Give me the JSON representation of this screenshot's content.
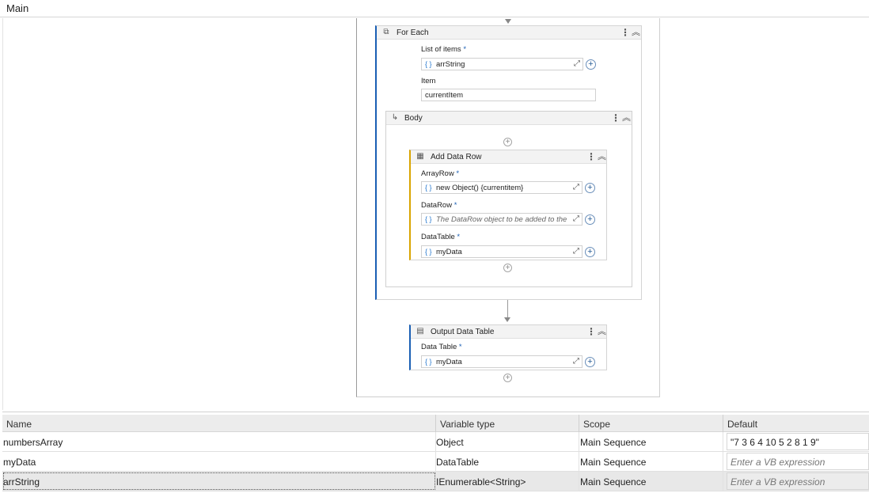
{
  "tab": {
    "title": "Main"
  },
  "for_each": {
    "title": "For Each",
    "list_label": "List of items",
    "list_value": "arrString",
    "item_label": "Item",
    "item_value": "currentItem",
    "body_title": "Body"
  },
  "add_data_row": {
    "title": "Add Data Row",
    "array_row_label": "ArrayRow",
    "array_row_value": "new Object() {currentitem}",
    "data_row_label": "DataRow",
    "data_row_placeholder": "The DataRow object to be added to the Dat",
    "data_table_label": "DataTable",
    "data_table_value": "myData"
  },
  "output_data_table": {
    "title": "Output Data Table",
    "data_table_label": "Data Table",
    "data_table_value": "myData"
  },
  "variables": {
    "headers": [
      "Name",
      "Variable type",
      "Scope",
      "Default"
    ],
    "rows": [
      {
        "name": "numbersArray",
        "type": "Object",
        "scope": "Main Sequence",
        "default": "\"7 3 6 4 10 5 2 8 1 9\"",
        "placeholder": false
      },
      {
        "name": "myData",
        "type": "DataTable",
        "scope": "Main Sequence",
        "default": "Enter a VB expression",
        "placeholder": true
      },
      {
        "name": "arrString",
        "type": "IEnumerable<String>",
        "scope": "Main Sequence",
        "default": "Enter a VB expression",
        "placeholder": true
      }
    ]
  },
  "required_marker": "*",
  "colors": {
    "accent_bar": "#1a5fb4",
    "warning_bar": "#d9a400"
  }
}
